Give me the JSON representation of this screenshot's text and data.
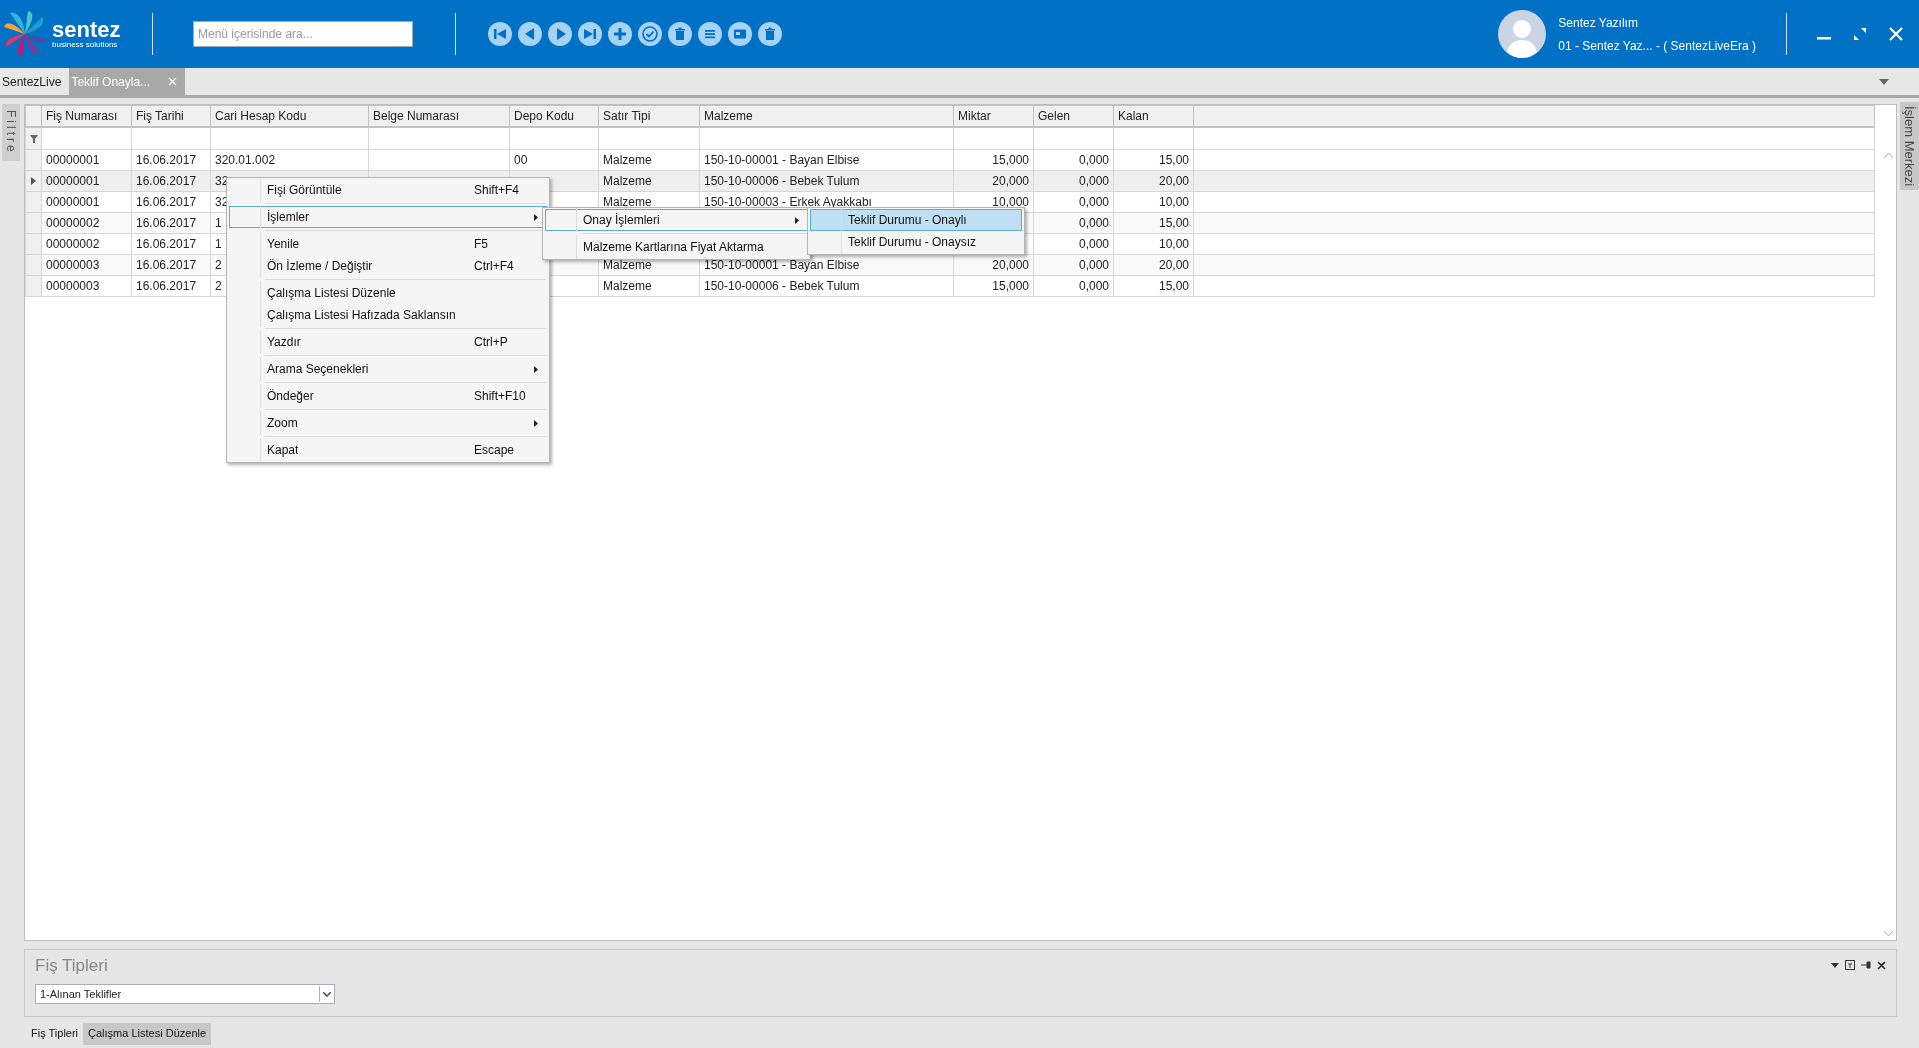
{
  "header": {
    "logo": {
      "name": "sentez",
      "tagline": "business solutions"
    },
    "search": {
      "placeholder": "Menü içerisinde ara..."
    },
    "user": {
      "name": "Sentez Yazılım",
      "company": "01 - Sentez Yaz... - ( SentezLiveEra )"
    }
  },
  "tabs": [
    {
      "label": "SentezLive",
      "selected": false,
      "closable": false
    },
    {
      "label": "Teklif Onayla...",
      "selected": true,
      "closable": true
    }
  ],
  "left_strip": {
    "label": "Filtre"
  },
  "right_strip": {
    "label": "İşlem Merkezi"
  },
  "grid": {
    "columns": [
      "Fiş Numarası",
      "Fiş Tarihi",
      "Cari Hesap Kodu",
      "Belge Numarası",
      "Depo Kodu",
      "Satır Tipi",
      "Malzeme",
      "Miktar",
      "Gelen",
      "Kalan"
    ],
    "rows": [
      {
        "current": false,
        "cells": [
          "00000001",
          "16.06.2017",
          "320.01.002",
          null,
          "00",
          "Malzeme",
          "150-10-00001 - Bayan Elbise",
          "15,000",
          "0,000",
          "15,00"
        ]
      },
      {
        "current": true,
        "cells": [
          "00000001",
          "16.06.2017",
          "32",
          null,
          null,
          "Malzeme",
          "150-10-00006 - Bebek Tulum",
          "20,000",
          "0,000",
          "20,00"
        ]
      },
      {
        "current": false,
        "cells": [
          "00000001",
          "16.06.2017",
          "32",
          null,
          null,
          "Malzeme",
          "150-10-00003 - Erkek Ayakkabı",
          "10,000",
          "0,000",
          "10,00"
        ]
      },
      {
        "current": false,
        "cells": [
          "00000002",
          "16.06.2017",
          "1",
          null,
          null,
          null,
          null,
          null,
          "0,000",
          "15,00"
        ]
      },
      {
        "current": false,
        "cells": [
          "00000002",
          "16.06.2017",
          "1",
          null,
          null,
          null,
          null,
          null,
          "0,000",
          "10,00"
        ]
      },
      {
        "current": false,
        "cells": [
          "00000003",
          "16.06.2017",
          "2",
          null,
          null,
          "Malzeme",
          "150-10-00001 - Bayan Elbise",
          "20,000",
          "0,000",
          "20,00"
        ]
      },
      {
        "current": false,
        "cells": [
          "00000003",
          "16.06.2017",
          "2",
          null,
          null,
          "Malzeme",
          "150-10-00006 - Bebek Tulum",
          "15,000",
          "0,000",
          "15,00"
        ]
      }
    ]
  },
  "context_menu": {
    "groups": [
      {
        "items": [
          {
            "label": "Fişi Görüntüle",
            "shortcut": "Shift+F4",
            "submenu": false,
            "selected": false
          }
        ]
      },
      {
        "items": [
          {
            "label": "İşlemler",
            "submenu": true,
            "selected": true
          }
        ]
      },
      {
        "items": [
          {
            "label": "Yenile",
            "shortcut": "F5",
            "submenu": false,
            "selected": false
          },
          {
            "label": "Ön İzleme / Değiştir",
            "shortcut": "Ctrl+F4",
            "submenu": false,
            "selected": false
          }
        ]
      },
      {
        "items": [
          {
            "label": "Çalışma Listesi Düzenle",
            "submenu": false,
            "selected": false
          },
          {
            "label": "Çalışma Listesi Hafızada Saklansın",
            "submenu": false,
            "selected": false
          }
        ]
      },
      {
        "items": [
          {
            "label": "Yazdır",
            "shortcut": "Ctrl+P",
            "submenu": false,
            "selected": false
          }
        ]
      },
      {
        "items": [
          {
            "label": "Arama Seçenekleri",
            "submenu": true,
            "selected": false
          }
        ]
      },
      {
        "items": [
          {
            "label": "Öndeğer",
            "shortcut": "Shift+F10",
            "submenu": false,
            "selected": false
          }
        ]
      },
      {
        "items": [
          {
            "label": "Zoom",
            "submenu": true,
            "selected": false
          }
        ]
      },
      {
        "items": [
          {
            "label": "Kapat",
            "shortcut": "Escape",
            "submenu": false,
            "selected": false
          }
        ]
      }
    ]
  },
  "submenu": {
    "groups": [
      {
        "items": [
          {
            "label": "Onay İşlemleri",
            "submenu": true,
            "selected": true
          }
        ]
      },
      {
        "items": [
          {
            "label": "Malzeme Kartlarına Fiyat Aktarma",
            "submenu": false,
            "selected": false
          }
        ]
      }
    ]
  },
  "submenu_2": {
    "groups": [
      {
        "items": [
          {
            "label": "Teklif Durumu - Onaylı",
            "submenu": false,
            "selected": true
          },
          {
            "label": "Teklif Durumu - Onaysız",
            "submenu": false,
            "selected": false
          }
        ]
      }
    ]
  },
  "bottom_panel": {
    "title": "Fiş Tipleri",
    "dropdown": {
      "value": "1-Alınan Teklifler"
    }
  },
  "bottom_tabs": [
    {
      "label": "Fiş Tipleri",
      "selected": true
    },
    {
      "label": "Çalışma Listesi Düzenle",
      "selected": false
    }
  ]
}
